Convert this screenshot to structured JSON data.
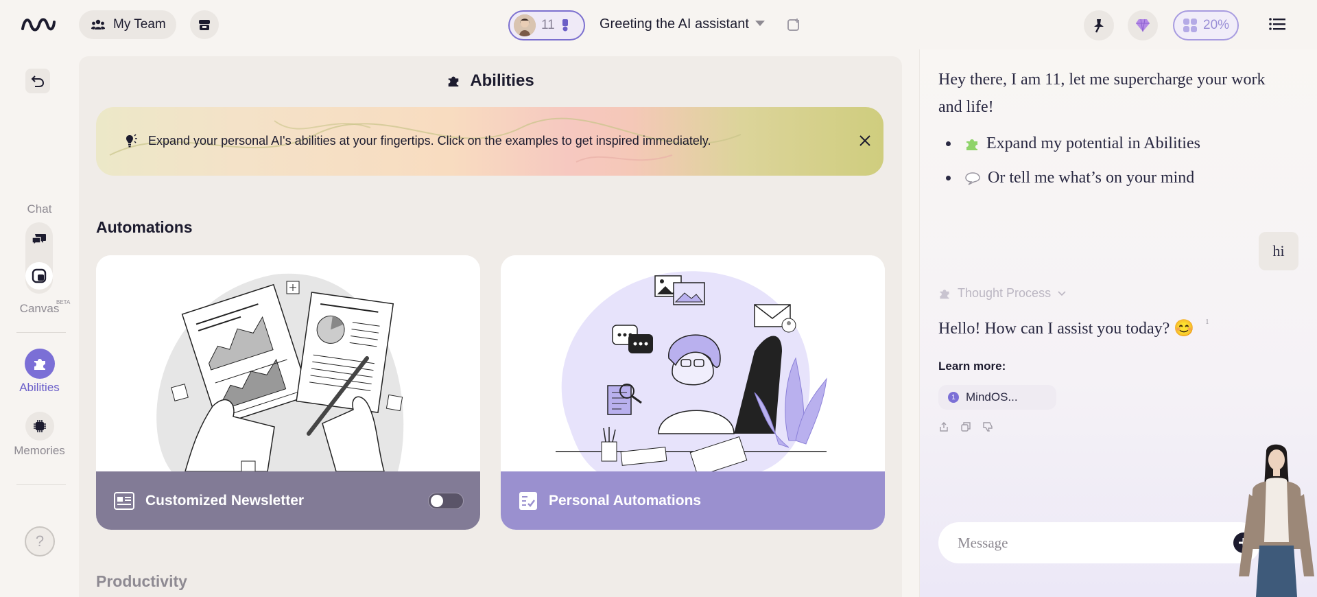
{
  "topbar": {
    "team_label": "My Team",
    "persona_number": "11",
    "session_title": "Greeting the AI assistant",
    "usage_percent": "20%"
  },
  "rail": {
    "chat_label": "Chat",
    "canvas_label": "Canvas",
    "canvas_badge": "BETA",
    "abilities_label": "Abilities",
    "memories_label": "Memories",
    "help_glyph": "?"
  },
  "main": {
    "title": "Abilities",
    "banner_text": "Expand your personal AI's abilities at your fingertips. Click on the examples to get inspired immediately.",
    "section_automations": "Automations",
    "section_productivity": "Productivity",
    "cards": [
      {
        "label": "Customized Newsletter",
        "toggle_on": false
      },
      {
        "label": "Personal Automations"
      }
    ]
  },
  "chat": {
    "greeting": "Hey there, I am 11, let me supercharge your work and life!",
    "bullets": [
      {
        "icon": "puzzle-icon",
        "text": "Expand my potential in Abilities"
      },
      {
        "icon": "speech-bubble-icon",
        "text": "Or tell me what’s on your mind"
      }
    ],
    "user_message": "hi",
    "thought_label": "Thought Process",
    "reply": "Hello! How can I assist you today? 😊",
    "reply_citation": "1",
    "learn_more": "Learn more:",
    "source": {
      "num": "1",
      "title": "MindOS..."
    },
    "composer_placeholder": "Message"
  },
  "colors": {
    "accent": "#7b6fd6",
    "background": "#f7f4f1",
    "newsletter_footer": "#827b96",
    "automations_footer": "#9a90cf"
  }
}
